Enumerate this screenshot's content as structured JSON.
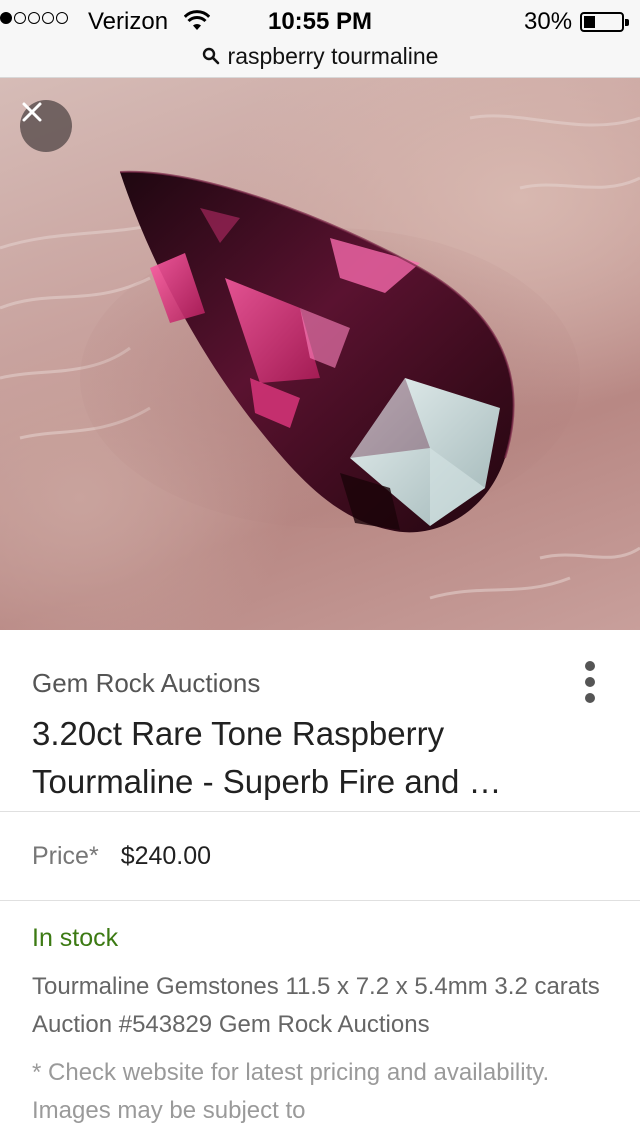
{
  "status_bar": {
    "signal_bars": 1,
    "signal_total": 5,
    "carrier": "Verizon",
    "time": "10:55 PM",
    "battery_percent": "30%",
    "battery_level": 0.3
  },
  "url_bar": {
    "query": "raspberry tourmaline",
    "icon": "search-icon"
  },
  "image_viewer": {
    "close_icon": "close-icon",
    "image_subject": "pear-shaped raspberry tourmaline gemstone on fingertip"
  },
  "result": {
    "seller": "Gem Rock Auctions",
    "title": "3.20ct Rare Tone Raspberry Tourmaline - Superb Fire and …",
    "more_icon": "more-vert-icon",
    "price_label": "Price*",
    "price": "$240.00",
    "availability": "In stock",
    "description": "Tourmaline Gemstones 11.5 x 7.2 x 5.4mm 3.2 carats Auction #543829 Gem Rock Auctions",
    "disclaimer": "* Check website for latest pricing and availability. Images may be subject to"
  },
  "colors": {
    "stock_green": "#3c7a13",
    "gem_dark": "#3a0b1c",
    "gem_pink": "#e0418a"
  }
}
